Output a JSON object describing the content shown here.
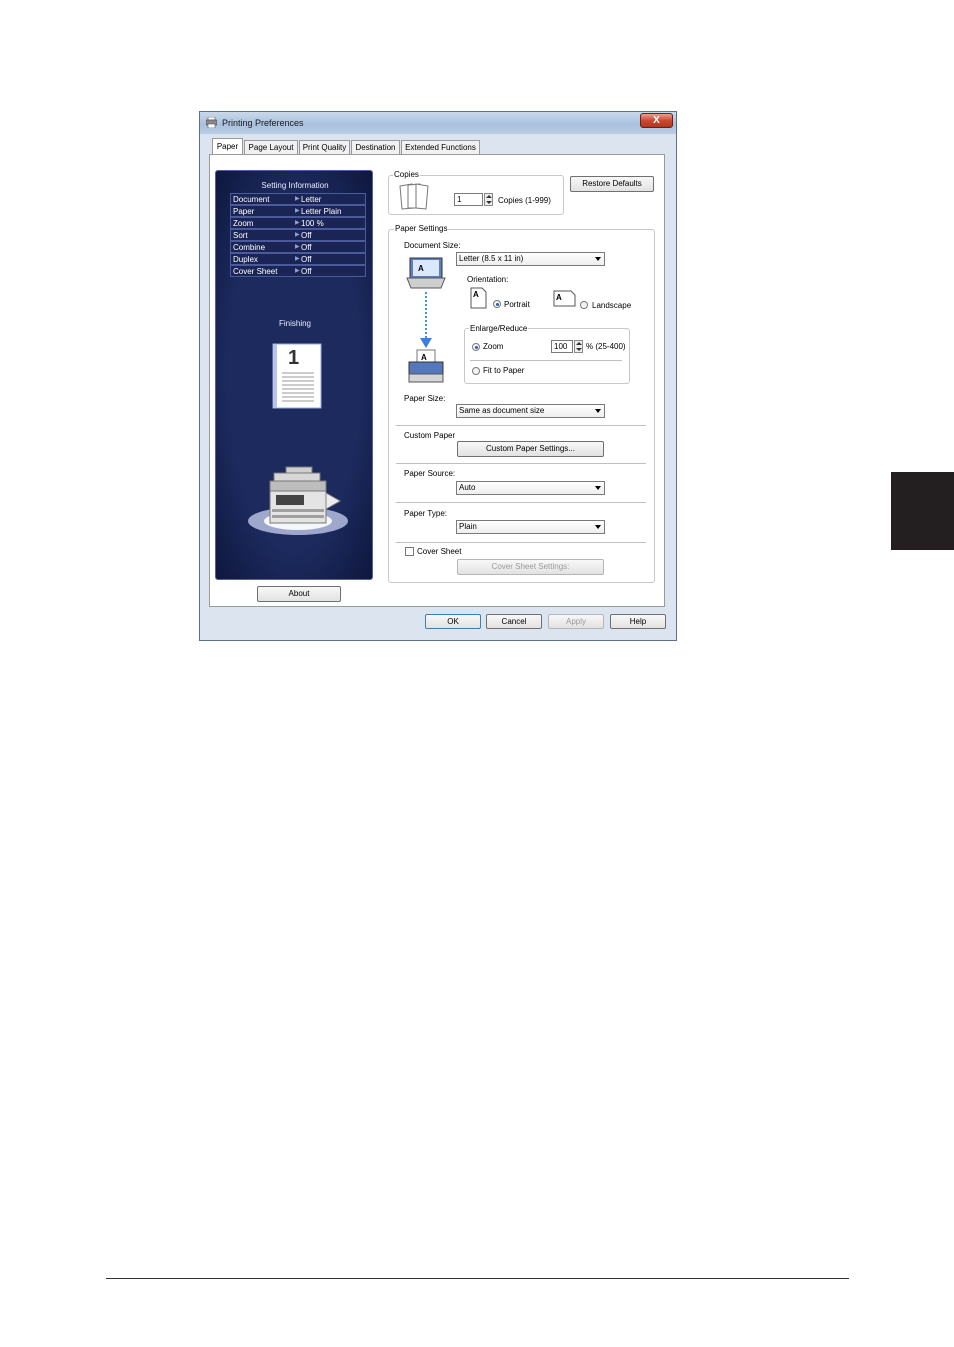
{
  "window": {
    "title": "Printing Preferences",
    "close_label": "X"
  },
  "tabs": [
    {
      "label": "Paper"
    },
    {
      "label": "Page Layout"
    },
    {
      "label": "Print Quality"
    },
    {
      "label": "Destination"
    },
    {
      "label": "Extended Functions"
    }
  ],
  "setting_info": {
    "title": "Setting Information",
    "rows": [
      {
        "key": "Document",
        "value": "Letter"
      },
      {
        "key": "Paper",
        "value": "Letter Plain"
      },
      {
        "key": "Zoom",
        "value": "100 %"
      },
      {
        "key": "Sort",
        "value": "Off"
      },
      {
        "key": "Combine",
        "value": "Off"
      },
      {
        "key": "Duplex",
        "value": "Off"
      },
      {
        "key": "Cover Sheet",
        "value": "Off"
      }
    ],
    "finishing_label": "Finishing",
    "page_number": "1"
  },
  "about_label": "About",
  "copies": {
    "group_label": "Copies",
    "value": "1",
    "range_label": "Copies (1-999)"
  },
  "restore_defaults_label": "Restore Defaults",
  "paper_settings": {
    "group_label": "Paper Settings",
    "document_size_label": "Document Size:",
    "document_size_value": "Letter (8.5 x 11 in)",
    "orientation_label": "Orientation:",
    "portrait_label": "Portrait",
    "landscape_label": "Landscape",
    "orientation_selected": "Portrait",
    "enlarge_label": "Enlarge/Reduce",
    "zoom_label": "Zoom",
    "zoom_value": "100",
    "zoom_range": "% (25-400)",
    "fit_label": "Fit to Paper",
    "paper_size_label": "Paper Size:",
    "paper_size_value": "Same as document size",
    "custom_paper_label": "Custom Paper",
    "custom_paper_button": "Custom Paper Settings...",
    "paper_source_label": "Paper Source:",
    "paper_source_value": "Auto",
    "paper_type_label": "Paper Type:",
    "paper_type_value": "Plain",
    "cover_sheet_label": "Cover Sheet",
    "cover_sheet_button": "Cover Sheet Settings:"
  },
  "footer_buttons": {
    "ok": "OK",
    "cancel": "Cancel",
    "apply": "Apply",
    "help": "Help"
  },
  "colors": {
    "info_panel_bg": "#1c2a5e",
    "window_frame": "#dbe4ef",
    "radio_selected": "#2a5db0",
    "side_marker": "#231f20"
  }
}
